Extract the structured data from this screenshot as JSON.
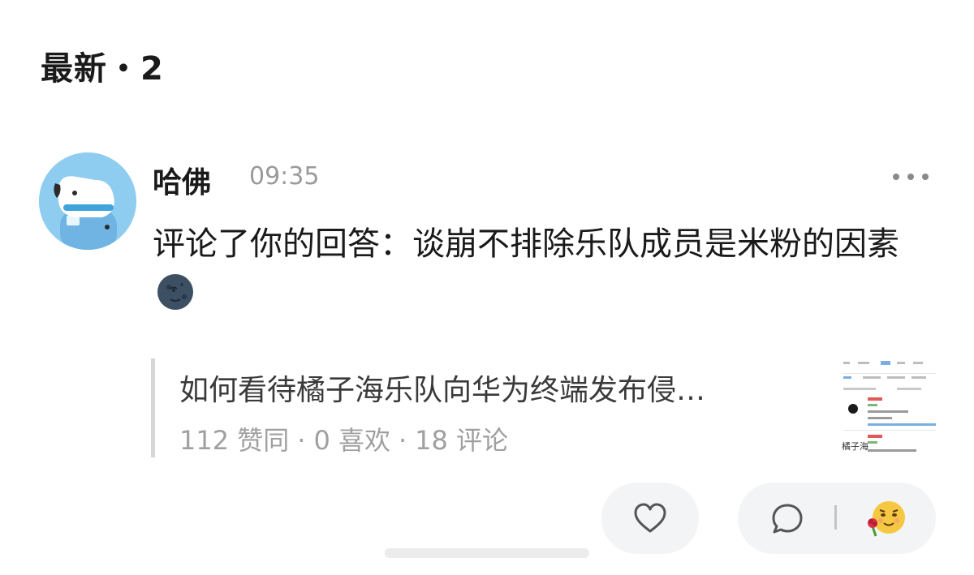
{
  "section": {
    "title": "最新・2"
  },
  "comment": {
    "username": "哈佛",
    "time": "09:35",
    "text": "评论了你的回答：谈崩不排除乐队成员是米粉的因素",
    "emoji": "new-moon-face-emoji"
  },
  "quote": {
    "title": "如何看待橘子海乐队向华为终端发布侵…",
    "stats": {
      "likes": "112 赞同",
      "favorites": "0 喜欢",
      "comments": "18 评论",
      "separator": "·"
    },
    "thumbnail_label": "橘子海"
  },
  "actions": {
    "like_icon": "heart-icon",
    "reply_icon": "speech-bubble-icon",
    "reaction_icon": "smiling-face-with-rose-icon"
  }
}
